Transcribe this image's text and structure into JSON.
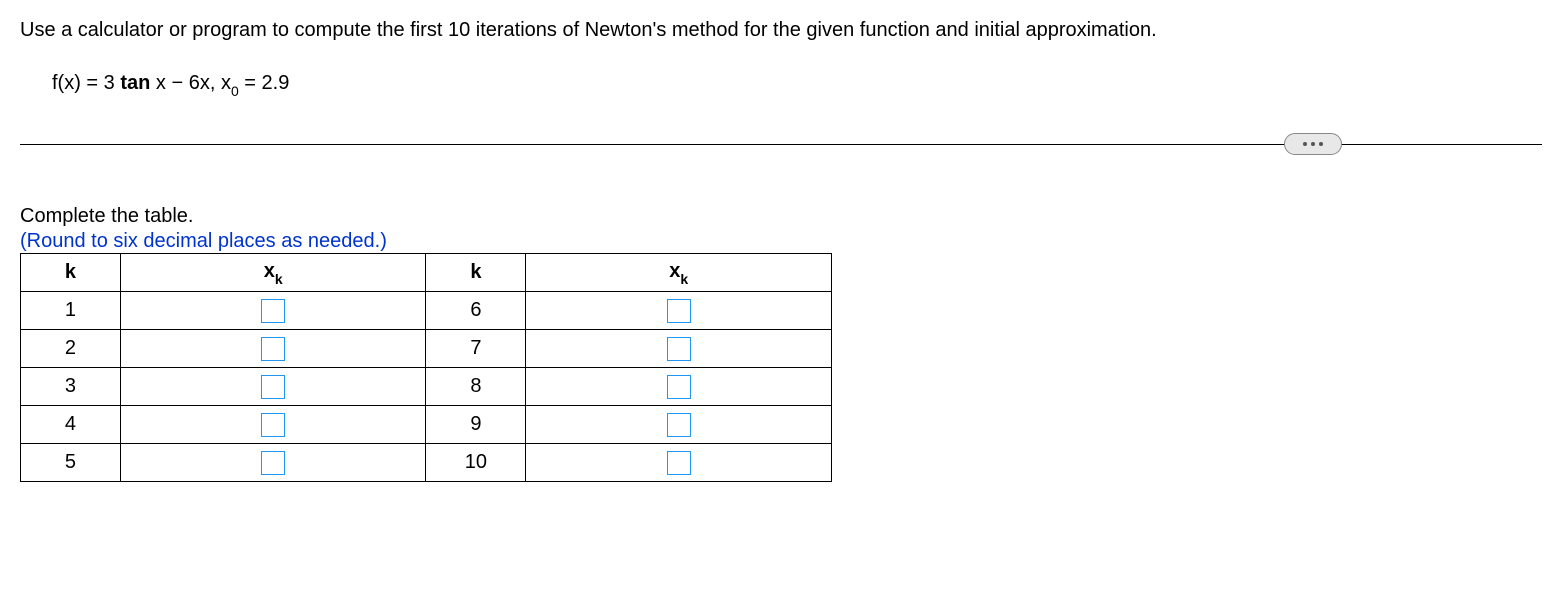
{
  "problem": {
    "intro": "Use a calculator or program to compute the first 10 iterations of Newton's method for the given function and initial approximation.",
    "function_prefix": "f(x) = 3 ",
    "function_tan": "tan",
    "function_mid": " x − 6x, x",
    "function_sub": "0",
    "function_suffix": " = 2.9"
  },
  "instructions": {
    "complete": "Complete the table.",
    "hint": "(Round to six decimal places as needed.)"
  },
  "table": {
    "header_k": "k",
    "header_xk_var": "x",
    "header_xk_sub": "k",
    "rows_left": [
      "1",
      "2",
      "3",
      "4",
      "5"
    ],
    "rows_right": [
      "6",
      "7",
      "8",
      "9",
      "10"
    ],
    "values_left": [
      "",
      "",
      "",
      "",
      ""
    ],
    "values_right": [
      "",
      "",
      "",
      "",
      ""
    ]
  }
}
